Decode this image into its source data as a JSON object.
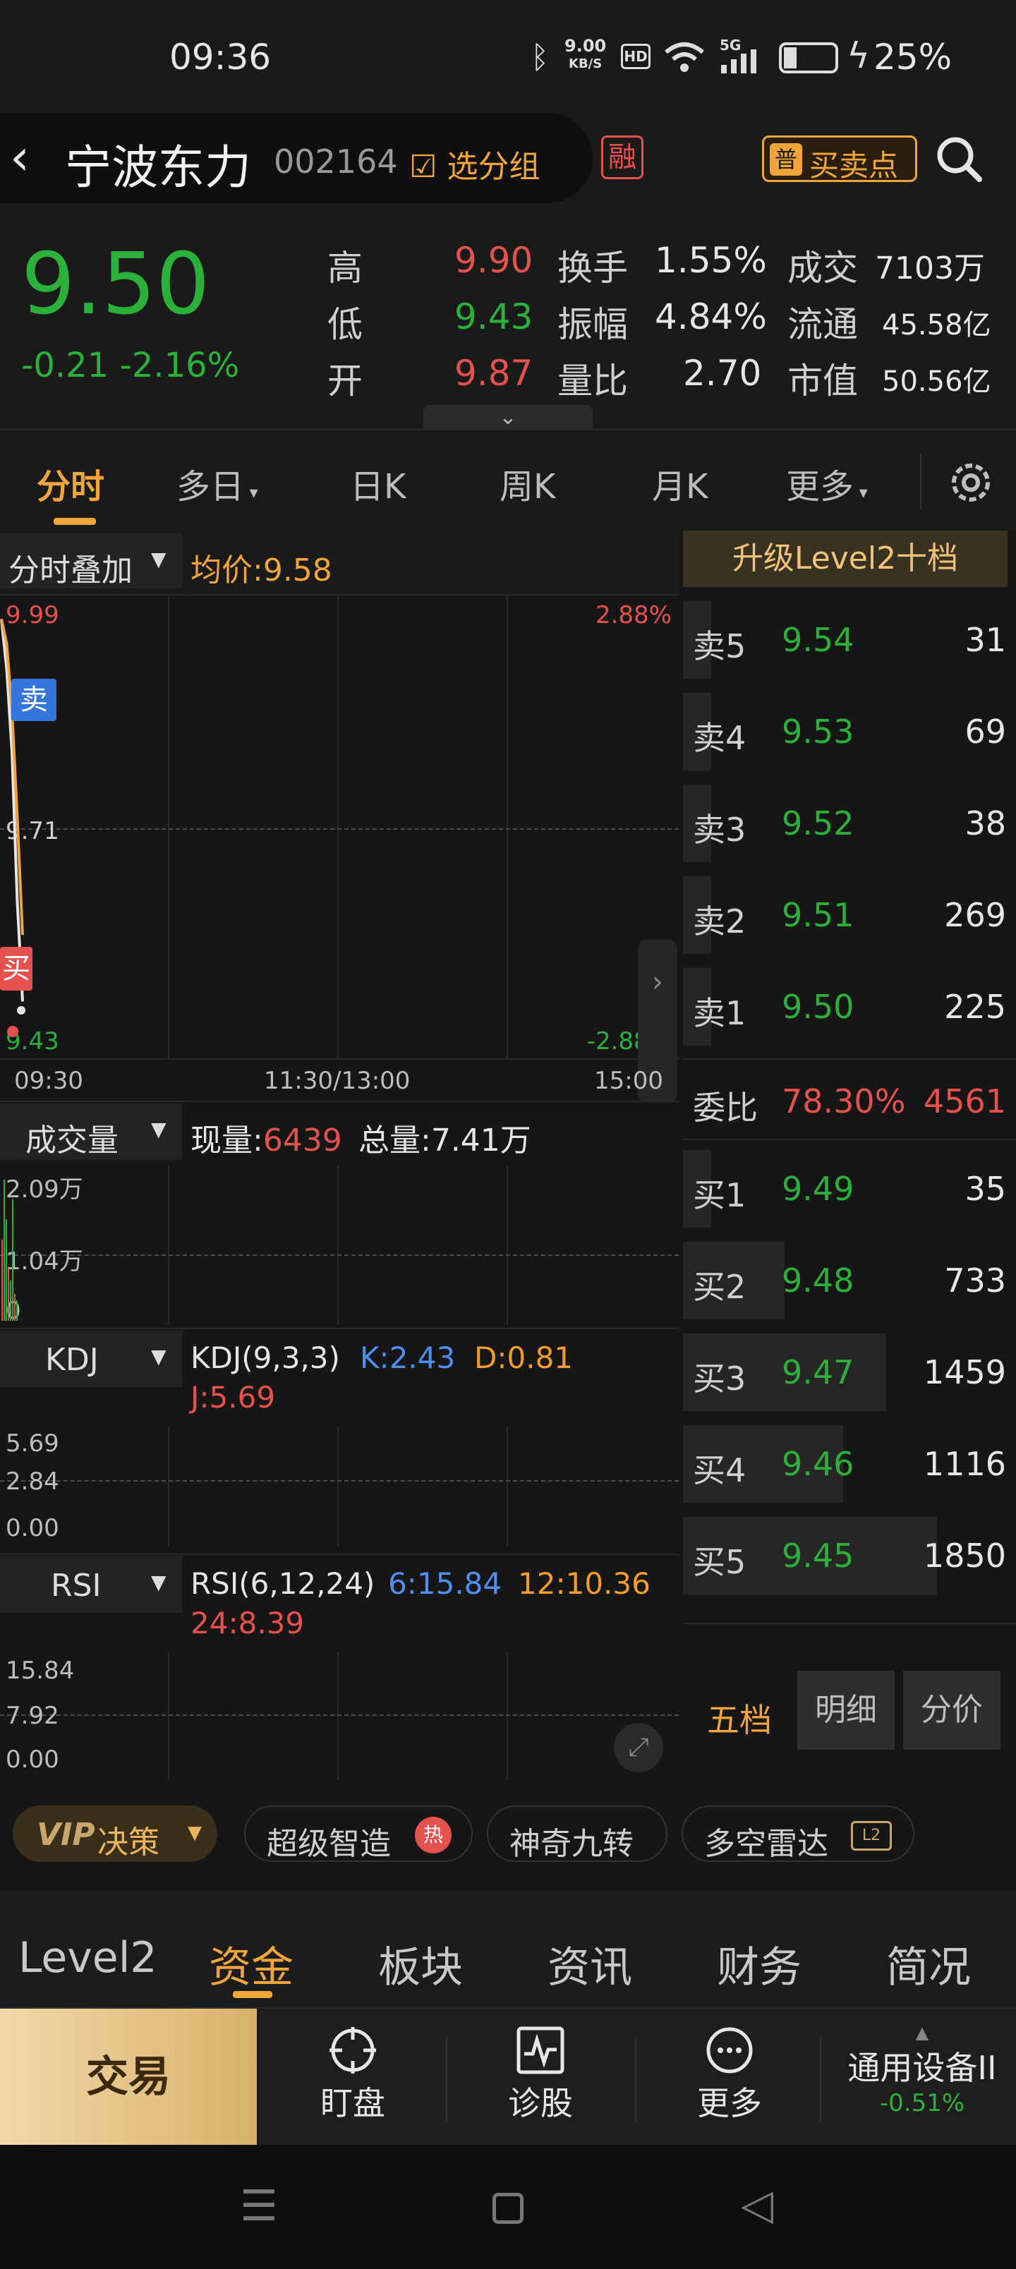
{
  "status": {
    "time": "09:36",
    "net_speed": "9.00",
    "net_unit": "KB/S",
    "hd": "HD",
    "signal": "5G",
    "battery": "25%"
  },
  "header": {
    "name": "宁波东力",
    "code": "002164",
    "group_label": "选分组",
    "rong": "融",
    "buysell_icon_text": "普",
    "buysell_label": "买卖点"
  },
  "quote": {
    "price": "9.50",
    "change": "-0.21",
    "change_pct": "-2.16%",
    "high_label": "高",
    "high": "9.90",
    "low_label": "低",
    "low": "9.43",
    "open_label": "开",
    "open": "9.87",
    "turnover_label": "换手",
    "turnover": "1.55%",
    "amplitude_label": "振幅",
    "amplitude": "4.84%",
    "ratio_label": "量比",
    "ratio": "2.70",
    "amount_label": "成交",
    "amount": "7103万",
    "float_label": "流通",
    "float_cap": "45.58亿",
    "mcap_label": "市值",
    "mcap": "50.56亿"
  },
  "tabs": {
    "t1": "分时",
    "t2": "多日",
    "t3": "日K",
    "t4": "周K",
    "t5": "月K",
    "t6": "更多"
  },
  "chart": {
    "overlay_label": "分时叠加",
    "avg_label": "均价:9.58",
    "y_top": "9.99",
    "y_mid": "9.71",
    "y_bot": "9.43",
    "pct_top": "2.88%",
    "pct_bot": "-2.88%",
    "x_start": "09:30",
    "x_mid": "11:30/13:00",
    "x_end": "15:00",
    "sell_tag": "卖",
    "buy_tag": "买"
  },
  "volume": {
    "label": "成交量",
    "now_label": "现量:",
    "now": "6439",
    "total_label": "总量:",
    "total": "7.41万",
    "y_top": "2.09万",
    "y_mid": "1.04万",
    "y_bot": "0"
  },
  "kdj": {
    "label": "KDJ",
    "title": "KDJ(9,3,3)",
    "k": "K:2.43",
    "d": "D:0.81",
    "j": "J:5.69",
    "y_top": "5.69",
    "y_mid": "2.84",
    "y_bot": "0.00"
  },
  "rsi": {
    "label": "RSI",
    "title": "RSI(6,12,24)",
    "r6": "6:15.84",
    "r12": "12:10.36",
    "r24": "24:8.39",
    "y_top": "15.84",
    "y_mid": "7.92",
    "y_bot": "0.00"
  },
  "orderbook": {
    "upgrade": "升级Level2十档",
    "sells": [
      {
        "label": "卖5",
        "price": "9.54",
        "vol": "31",
        "w": 0.04
      },
      {
        "label": "卖4",
        "price": "9.53",
        "vol": "69",
        "w": 0.05
      },
      {
        "label": "卖3",
        "price": "9.52",
        "vol": "38",
        "w": 0.04
      },
      {
        "label": "卖2",
        "price": "9.51",
        "vol": "269",
        "w": 0.08
      },
      {
        "label": "卖1",
        "price": "9.50",
        "vol": "225",
        "w": 0.07
      }
    ],
    "wb_label": "委比",
    "wb_pct": "78.30%",
    "wb_val": "4561",
    "buys": [
      {
        "label": "买1",
        "price": "9.49",
        "vol": "35",
        "w": 0.04
      },
      {
        "label": "买2",
        "price": "9.48",
        "vol": "733",
        "w": 0.4
      },
      {
        "label": "买3",
        "price": "9.47",
        "vol": "1459",
        "w": 0.8
      },
      {
        "label": "买4",
        "price": "9.46",
        "vol": "1116",
        "w": 0.63
      },
      {
        "label": "买5",
        "price": "9.45",
        "vol": "1850",
        "w": 1.0
      }
    ],
    "tab1": "五档",
    "tab2": "明细",
    "tab3": "分价"
  },
  "tools": {
    "vip": "VIP",
    "vip_label": "决策",
    "t1": "超级智造",
    "hot": "热",
    "t2": "神奇九转",
    "t3": "多空雷达",
    "l2": "L2"
  },
  "bottom_tabs": {
    "b1": "Level2",
    "b2": "资金",
    "b3": "板块",
    "b4": "资讯",
    "b5": "财务",
    "b6": "简况"
  },
  "actions": {
    "trade": "交易",
    "watch": "盯盘",
    "diag": "诊股",
    "more": "更多",
    "sector": "通用设备II",
    "sector_chg": "-0.51%"
  },
  "colors": {
    "up": "#e5524d",
    "down": "#2bb13a",
    "accent": "#f0a53a"
  },
  "chart_data": {
    "type": "line",
    "price_series": [
      9.96,
      9.9,
      9.8,
      9.62,
      9.5
    ],
    "avg_series": [
      9.96,
      9.93,
      9.85,
      9.72,
      9.58
    ],
    "ylim": [
      9.43,
      9.99
    ],
    "volume_series": [
      1.2,
      2.09,
      1.5,
      0.8,
      0.6,
      1.8,
      0.4,
      0.3
    ],
    "volume_ylim": [
      0,
      2.09
    ]
  }
}
